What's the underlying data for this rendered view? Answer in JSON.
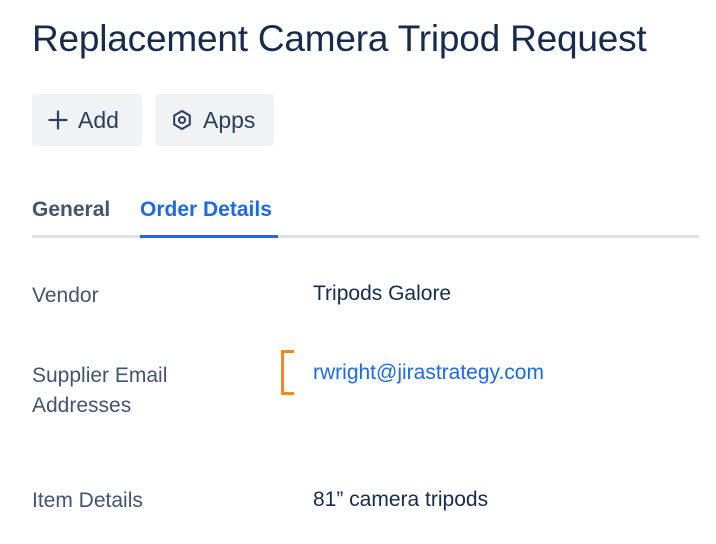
{
  "page": {
    "title": "Replacement Camera Tripod Request"
  },
  "toolbar": {
    "add_label": "Add",
    "apps_label": "Apps",
    "add_icon": "plus-icon",
    "apps_icon": "hexagon-apps-icon"
  },
  "tabs": [
    {
      "label": "General",
      "active": false
    },
    {
      "label": "Order Details",
      "active": true
    }
  ],
  "fields": {
    "vendor": {
      "label": "Vendor",
      "value": "Tripods Galore"
    },
    "supplier_email": {
      "label_line1": "Supplier Email",
      "label_line2": "Addresses",
      "value": "rwright@jirastrategy.com"
    },
    "item_details": {
      "label": "Item Details",
      "value": "81” camera tripods"
    }
  },
  "colors": {
    "accent": "#1d6ae5",
    "highlight_bracket": "#f08a24",
    "button_bg": "#f1f2f4"
  }
}
